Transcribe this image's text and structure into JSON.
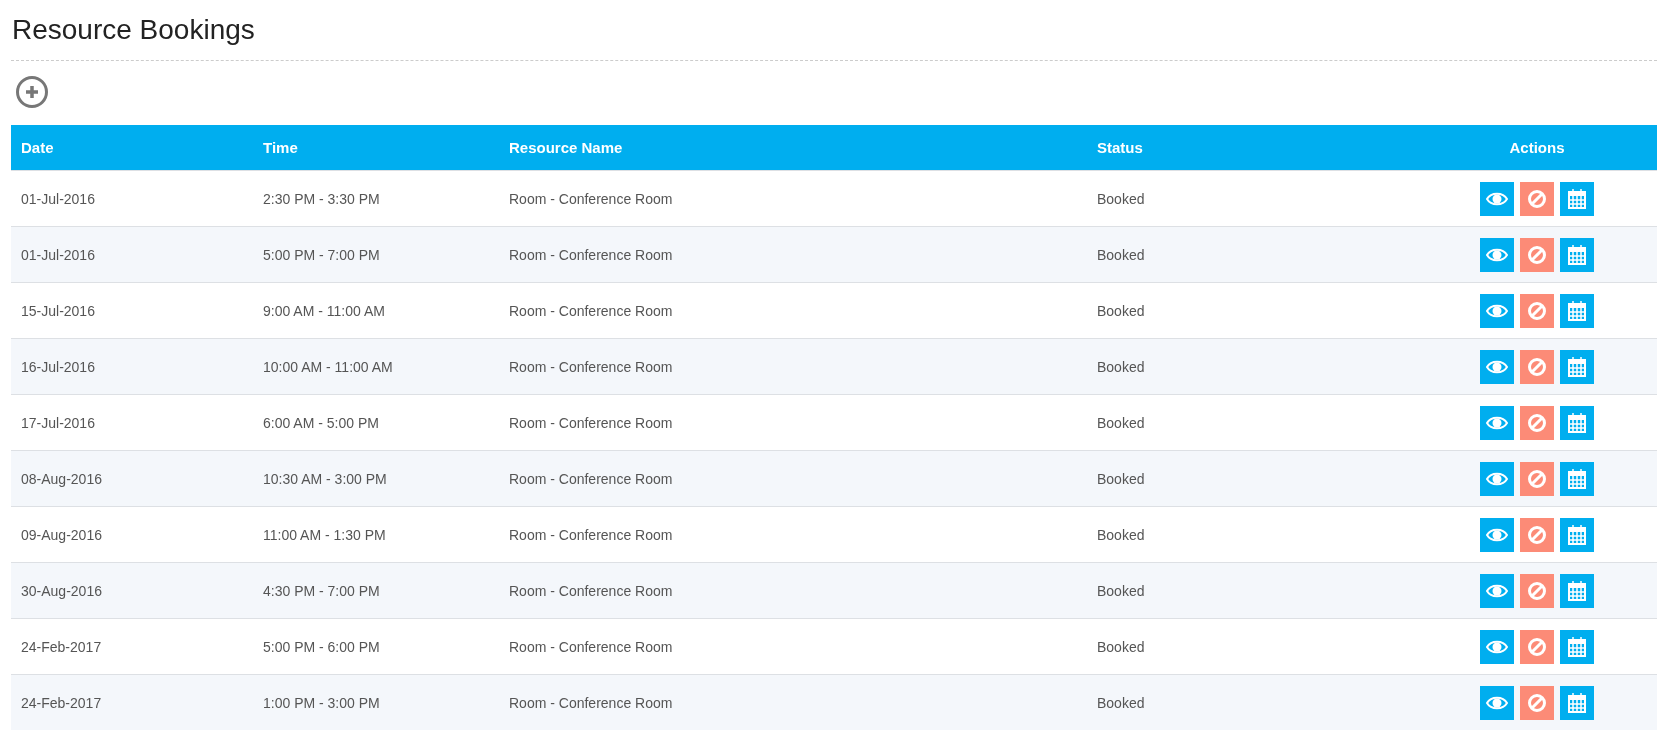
{
  "page": {
    "title": "Resource Bookings"
  },
  "table": {
    "columns": [
      "Date",
      "Time",
      "Resource Name",
      "Status",
      "Actions"
    ],
    "rows": [
      {
        "date": "01-Jul-2016",
        "time": "2:30 PM - 3:30 PM",
        "resource": "Room - Conference Room",
        "status": "Booked"
      },
      {
        "date": "01-Jul-2016",
        "time": "5:00 PM - 7:00 PM",
        "resource": "Room - Conference Room",
        "status": "Booked"
      },
      {
        "date": "15-Jul-2016",
        "time": "9:00 AM - 11:00 AM",
        "resource": "Room - Conference Room",
        "status": "Booked"
      },
      {
        "date": "16-Jul-2016",
        "time": "10:00 AM - 11:00 AM",
        "resource": "Room - Conference Room",
        "status": "Booked"
      },
      {
        "date": "17-Jul-2016",
        "time": "6:00 AM - 5:00 PM",
        "resource": "Room - Conference Room",
        "status": "Booked"
      },
      {
        "date": "08-Aug-2016",
        "time": "10:30 AM - 3:00 PM",
        "resource": "Room - Conference Room",
        "status": "Booked"
      },
      {
        "date": "09-Aug-2016",
        "time": "11:00 AM - 1:30 PM",
        "resource": "Room - Conference Room",
        "status": "Booked"
      },
      {
        "date": "30-Aug-2016",
        "time": "4:30 PM - 7:00 PM",
        "resource": "Room - Conference Room",
        "status": "Booked"
      },
      {
        "date": "24-Feb-2017",
        "time": "5:00 PM - 6:00 PM",
        "resource": "Room - Conference Room",
        "status": "Booked"
      },
      {
        "date": "24-Feb-2017",
        "time": "1:00 PM - 3:00 PM",
        "resource": "Room - Conference Room",
        "status": "Booked"
      }
    ]
  }
}
